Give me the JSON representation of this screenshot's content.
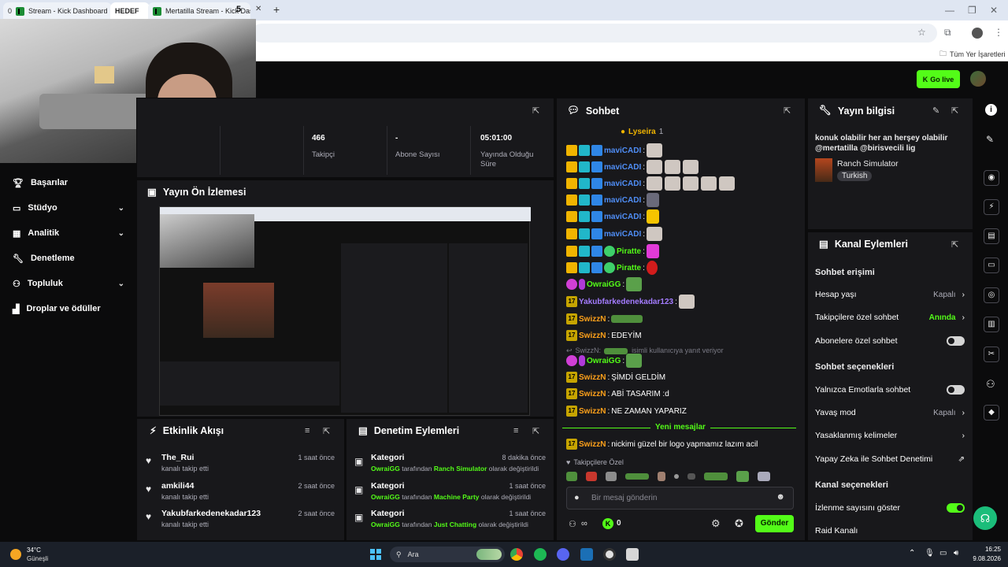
{
  "browser": {
    "tabs": [
      {
        "badge": "0",
        "title": "Stream - Kick Dashboard"
      },
      {
        "title": "HEDEF"
      },
      {
        "title": "Mertatilla Stream - Kick Dashboard"
      }
    ],
    "tab_counter": "5",
    "bookmarks_label": "Tüm Yer İşaretleri"
  },
  "topbar": {
    "go_live": "Go live"
  },
  "sidebar": {
    "items": [
      {
        "label": "Başarılar",
        "icon": "trophy-icon",
        "chevron": false
      },
      {
        "label": "Stüdyo",
        "icon": "studio-icon",
        "chevron": true
      },
      {
        "label": "Analitik",
        "icon": "analytics-icon",
        "chevron": true
      },
      {
        "label": "Denetleme",
        "icon": "wrench-icon",
        "chevron": false
      },
      {
        "label": "Topluluk",
        "icon": "community-icon",
        "chevron": true
      },
      {
        "label": "Droplar ve ödüller",
        "icon": "drops-icon",
        "chevron": false
      }
    ]
  },
  "stats": [
    {
      "value": "466",
      "label": "Takipçi"
    },
    {
      "value": "-",
      "label": "Abone Sayısı"
    },
    {
      "value": "05:01:00",
      "label": "Yayında Olduğu Süre"
    }
  ],
  "preview": {
    "title": "Yayın Ön İzlemesi"
  },
  "activity": {
    "title": "Etkinlik Akışı",
    "items": [
      {
        "name": "The_Rui",
        "text": "kanalı takip etti",
        "time": "1 saat önce"
      },
      {
        "name": "amkili44",
        "text": "kanalı takip etti",
        "time": "2 saat önce"
      },
      {
        "name": "Yakubfarkedenekadar123",
        "text": "kanalı takip etti",
        "time": "2 saat önce"
      }
    ]
  },
  "moderation": {
    "title": "Denetim Eylemleri",
    "items": [
      {
        "title": "Kategori",
        "actor": "OwraiGG",
        "mid": "tarafından",
        "target": "Ranch Simulator",
        "end": "olarak değiştirildi",
        "time": "8 dakika önce"
      },
      {
        "title": "Kategori",
        "actor": "OwraiGG",
        "mid": "tarafından",
        "target": "Machine Party",
        "end": "olarak değiştirildi",
        "time": "1 saat önce"
      },
      {
        "title": "Kategori",
        "actor": "OwraiGG",
        "mid": "tarafından",
        "target": "Just Chatting",
        "end": "olarak değiştirildi",
        "time": "1 saat önce"
      }
    ]
  },
  "chat": {
    "title": "Sohbet",
    "pinned_user": "Lyseira",
    "pinned_count": "1",
    "new_messages": "Yeni mesajlar",
    "reply_prefix": "SwizzN:",
    "reply_text": "isimli kullanıcıya yanıt veriyor",
    "followers_only": "Takipçilere Özel",
    "placeholder": "Bir mesaj gönderin",
    "count": "0",
    "send": "Gönder",
    "lines": [
      {
        "user": "maviCADI",
        "text": ""
      },
      {
        "user": "maviCADI",
        "text": ""
      },
      {
        "user": "maviCADI",
        "text": ""
      },
      {
        "user": "maviCADI",
        "text": ""
      },
      {
        "user": "maviCADI",
        "text": ""
      },
      {
        "user": "maviCADI",
        "text": ""
      },
      {
        "user": "Piratte",
        "text": ""
      },
      {
        "user": "Piratte",
        "text": ""
      },
      {
        "user": "OwraiGG",
        "text": ""
      },
      {
        "user": "Yakubfarkedenekadar123",
        "text": ""
      },
      {
        "user": "SwizzN",
        "text": ""
      },
      {
        "user": "SwizzN",
        "text": "EDEYİM"
      },
      {
        "user": "OwraiGG",
        "text": ""
      },
      {
        "user": "SwizzN",
        "text": "ŞİMDİ GELDİM"
      },
      {
        "user": "SwizzN",
        "text": "ABİ TASARIM :d"
      },
      {
        "user": "SwizzN",
        "text": "NE ZAMAN YAPARIZ"
      },
      {
        "user": "SwizzN",
        "text": "nickimi güzel bir logo yapmamız lazım acil"
      }
    ]
  },
  "stream_info": {
    "title": "Yayın bilgisi",
    "description": "konuk olabilir her an herşey olabilir @mertatilla @birisvecili lig",
    "category": "Ranch Simulator",
    "tag": "Turkish"
  },
  "channel_actions": {
    "title": "Kanal Eylemleri",
    "sections": {
      "chat_access": "Sohbet erişimi",
      "chat_options": "Sohbet seçenekleri",
      "channel_options": "Kanal seçenekleri"
    },
    "rows": {
      "account_age": {
        "label": "Hesap yaşı",
        "value": "Kapalı"
      },
      "followers_only": {
        "label": "Takipçilere özel sohbet",
        "value": "Anında"
      },
      "subs_only": {
        "label": "Abonelere özel sohbet"
      },
      "emote_only": {
        "label": "Yalnızca Emotlarla sohbet"
      },
      "slow_mode": {
        "label": "Yavaş mod",
        "value": "Kapalı"
      },
      "banned_words": {
        "label": "Yasaklanmış kelimeler"
      },
      "ai_moderation": {
        "label": "Yapay Zeka ile Sohbet Denetimi"
      },
      "show_viewers": {
        "label": "İzlenme sayısını göster"
      },
      "raid": {
        "label": "Raid Kanalı"
      }
    }
  },
  "taskbar": {
    "weather_temp": "34°C",
    "weather_text": "Güneşli",
    "search": "Ara",
    "time": "16:25",
    "date": "9.08.2026"
  }
}
